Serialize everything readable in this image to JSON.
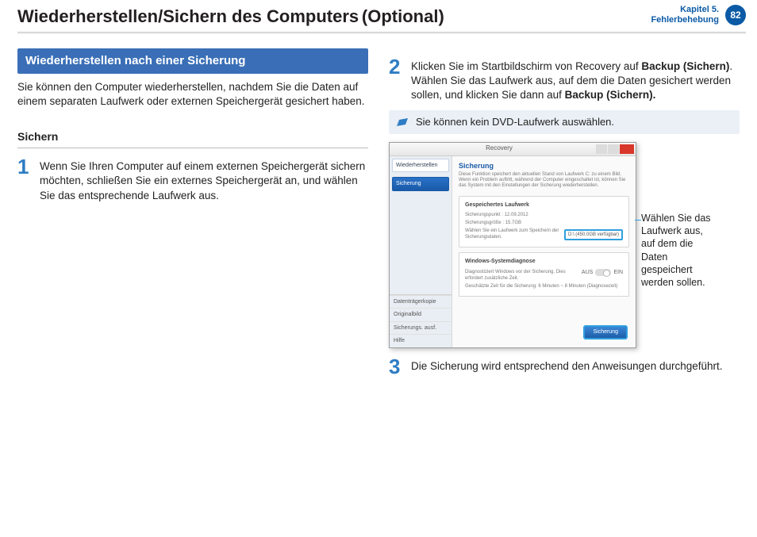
{
  "header": {
    "title_main": "Wiederherstellen/Sichern des Computers",
    "title_optional": "(Optional)",
    "chapter_line1": "Kapitel 5.",
    "chapter_line2": "Fehlerbehebung",
    "page": "82"
  },
  "left": {
    "blue_heading": "Wiederherstellen nach einer Sicherung",
    "intro": "Sie können den Computer wiederherstellen, nachdem Sie die Daten auf einem separaten Laufwerk oder externen Speichergerät gesichert haben.",
    "subhead": "Sichern",
    "step1_num": "1",
    "step1_text": "Wenn Sie Ihren Computer auf einem externen Speichergerät sichern möchten, schließen Sie ein externes Speichergerät an, und wählen Sie das entsprechende Laufwerk aus."
  },
  "right": {
    "step2_num": "2",
    "step2_a": "Klicken Sie im Startbildschirm von Recovery auf ",
    "step2_b1": "Backup (Sichern)",
    "step2_c": ".",
    "step2_d": "Wählen Sie das Laufwerk aus, auf dem die Daten gesichert werden sollen, und klicken Sie dann auf ",
    "step2_b2": "Backup (Sichern).",
    "note": "Sie können kein DVD-Laufwerk auswählen.",
    "callout": "Wählen Sie das Laufwerk aus, auf dem die Daten gespeichert werden sollen.",
    "step3_num": "3",
    "step3_text": "Die Sicherung wird entsprechend den Anweisungen durchgeführt."
  },
  "shot": {
    "title": "Recovery",
    "side_restore": "Wiederherstellen",
    "side_backup": "Sicherung",
    "side_b1": "Datenträgerkopie",
    "side_b2": "Originalbild",
    "side_b3": "Sicherungs. ausf.",
    "side_b4": "Hilfe",
    "main_h": "Sicherung",
    "main_sub": "Diese Funktion speichert den aktuellen Stand von Laufwerk C: zu einem Bild. Wenn ein Problem auftritt, während der Computer eingeschaltet ist, können Sie das System mit den Einstellungen der Sicherung wiederherstellen.",
    "panel1_h": "Gespeichertes Laufwerk",
    "panel1_l1": "Sicherungspunkt : 12.09.2012",
    "panel1_l2": "Sicherungsgröße : 15.7GB",
    "panel1_l3": "Wählen Sie ein Laufwerk zum Speichern der Sicherungsdaten.",
    "panel1_drive": "D:\\ (450.0GB verfügbar)",
    "panel2_h": "Windows-Systemdiagnose",
    "panel2_l1": "Diagnostiziert Windows vor der Sicherung. Dies erfordert zusätzliche Zeit.",
    "panel2_l2": "Geschätzte Zeit für die Sicherung: 6 Minuten ~ 8 Minuten (Diagnosezeit)",
    "toggle_off": "AUS",
    "toggle_on": "EIN",
    "btn": "Sicherung"
  }
}
